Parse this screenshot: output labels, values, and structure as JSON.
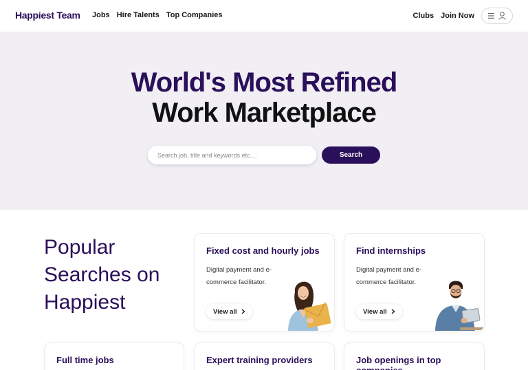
{
  "header": {
    "logo": "Happiest Team",
    "nav": [
      "Jobs",
      "Hire Talents",
      "Top Companies"
    ],
    "right": [
      "Clubs",
      "Join Now"
    ]
  },
  "hero": {
    "line1": "World's Most Refined",
    "line2": "Work Marketplace",
    "search_placeholder": "Search job, title and keywords etc....",
    "search_button": "Search"
  },
  "popular": {
    "title": "Popular Searches on Happiest"
  },
  "cards": [
    {
      "title": "Fixed cost and hourly jobs",
      "desc": "Digital payment and e-commerce facilitator.",
      "cta": "View all"
    },
    {
      "title": "Find internships",
      "desc": "Digital payment and e-commerce facilitator.",
      "cta": "View all"
    },
    {
      "title": "Full time jobs"
    },
    {
      "title": "Expert training providers"
    },
    {
      "title": "Job openings in top companies"
    }
  ],
  "colors": {
    "brand": "#2a0f5a",
    "hero_bg": "#f1eff4",
    "accent_envelope": "#e9b24a"
  }
}
